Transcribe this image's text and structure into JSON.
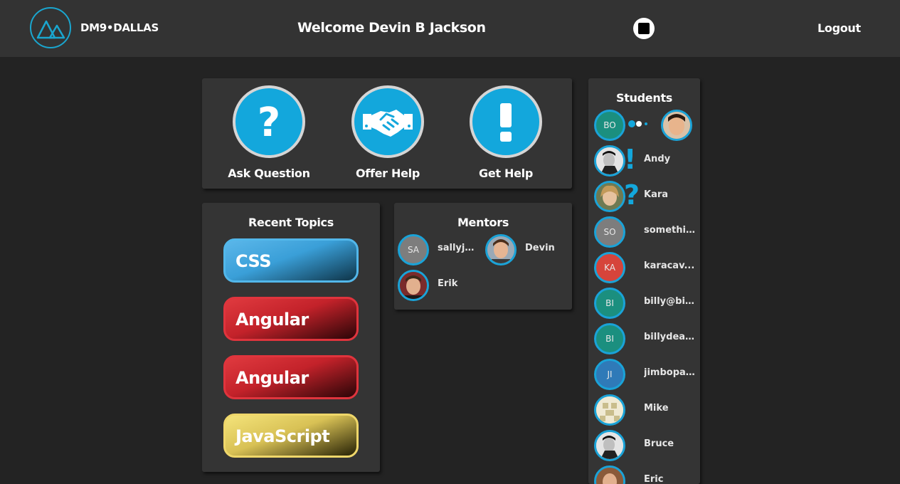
{
  "header": {
    "logo_text": "DM9•DALLAS",
    "welcome": "Welcome Devin B Jackson",
    "logout": "Logout"
  },
  "actions": [
    {
      "label": "Ask Question",
      "icon": "question-icon"
    },
    {
      "label": "Offer Help",
      "icon": "handshake-icon"
    },
    {
      "label": "Get Help",
      "icon": "exclamation-icon"
    }
  ],
  "topics": {
    "title": "Recent Topics",
    "items": [
      "CSS",
      "Angular",
      "Angular",
      "JavaScript"
    ]
  },
  "mentors": {
    "title": "Mentors",
    "items": [
      {
        "initials": "SA",
        "name": "sallyjp..."
      },
      {
        "initials": "",
        "name": "Devin"
      },
      {
        "initials": "",
        "name": "Erik"
      }
    ]
  },
  "students": {
    "title": "Students",
    "items": [
      {
        "initials": "BO",
        "name": ""
      },
      {
        "initials": "",
        "name": "Andy",
        "status": "!"
      },
      {
        "initials": "",
        "name": "Kara",
        "status": "?"
      },
      {
        "initials": "SO",
        "name": "somethin..."
      },
      {
        "initials": "KA",
        "name": "karacav..."
      },
      {
        "initials": "BI",
        "name": "billy@bill..."
      },
      {
        "initials": "BI",
        "name": "billydean..."
      },
      {
        "initials": "JI",
        "name": "jimbopa..."
      },
      {
        "initials": "",
        "name": "Mike"
      },
      {
        "initials": "",
        "name": "Bruce"
      },
      {
        "initials": "",
        "name": "Eric"
      }
    ]
  },
  "colors": {
    "accent": "#13a7dc",
    "panel": "#343434",
    "background": "#232323",
    "topbar": "#333333",
    "css": "#4aaee4",
    "angular": "#d42a32",
    "javascript": "#ecd86c",
    "teal_avatar": "#1b8f7f",
    "red_avatar": "#d6443b",
    "grey_avatar": "#7d7d7d",
    "blue_avatar": "#2f7ab8"
  }
}
